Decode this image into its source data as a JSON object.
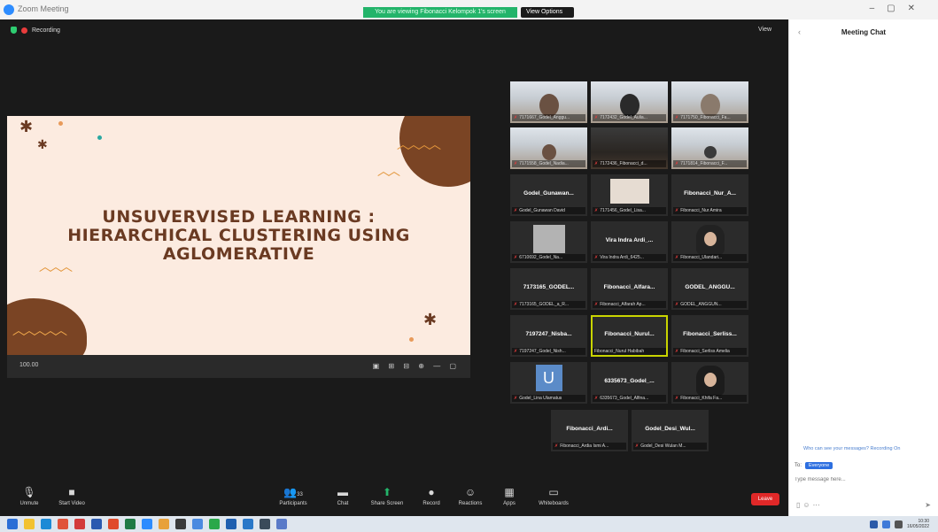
{
  "window": {
    "title": "Zoom Meeting",
    "share_banner": "You are viewing Fibonacci Kelompok 1's screen",
    "stop_share": "View Options"
  },
  "status": {
    "recording": "Recording",
    "view": "View"
  },
  "slide": {
    "title_lines": [
      "UNSUVERVISED LEARNING :",
      "HIERARCHICAL CLUSTERING USING",
      "AGLOMERATIVE"
    ],
    "zoom": "100.00",
    "tools": "▣ ⊞ ⊟ ⊕ — ▢"
  },
  "participants": [
    {
      "id": "p1",
      "big": "",
      "label": "7171667_Godel_Anggu..."
    },
    {
      "id": "p2",
      "big": "",
      "label": "7172432_Godel_Aulia..."
    },
    {
      "id": "p3",
      "big": "",
      "label": "7171750_Fibonacci_Fa..."
    },
    {
      "id": "p4",
      "big": "",
      "label": "7171558_Godel_Nadia..."
    },
    {
      "id": "p5",
      "big": "",
      "label": "7172436_Fibonacci_d..."
    },
    {
      "id": "p6",
      "big": "",
      "label": "7171814_Fibonacci_F..."
    },
    {
      "id": "p7",
      "big": "Godel_Gunawan...",
      "label": "Godel_Gunawan David"
    },
    {
      "id": "p8",
      "big": "",
      "label": "7171456_Godel_Lisa..."
    },
    {
      "id": "p9",
      "big": "Fibonacci_Nur_A...",
      "label": "Fibonacci_Nur Amira"
    },
    {
      "id": "p10",
      "big": "",
      "label": "6710692_Godel_Na..."
    },
    {
      "id": "p11",
      "big": "Vira Indra Ardi_...",
      "label": "Vira Indra Ardi_6425..."
    },
    {
      "id": "p12",
      "big": "",
      "label": "Fibonacci_Ulandari..."
    },
    {
      "id": "p13",
      "big": "7173165_GODEL...",
      "label": "7173165_GODEL_a_R..."
    },
    {
      "id": "p14",
      "big": "Fibonacci_Alfara...",
      "label": "Fibonacci_Alfarah Ap..."
    },
    {
      "id": "p15",
      "big": "GODEL_ANGGU...",
      "label": "GODEL_ANGGUN..."
    },
    {
      "id": "p16",
      "big": "7197247_Nisba...",
      "label": "7197247_Godel_Nish..."
    },
    {
      "id": "p17",
      "big": "Fibonacci_Nurul...",
      "label": "Fibonacci_Nurul Habibah"
    },
    {
      "id": "p18",
      "big": "Fibonacci_Serliss...",
      "label": "Fibonacci_Serliss Amelia"
    },
    {
      "id": "p19",
      "big": "",
      "label": "Godel_Lina Ulamatus"
    },
    {
      "id": "p20",
      "big": "6335673_Godel_...",
      "label": "6335673_Godel_Alfina..."
    },
    {
      "id": "p21",
      "big": "",
      "label": "Fibonacci_Khifa Fa..."
    },
    {
      "id": "p22",
      "big": "Fibonacci_Ardi...",
      "label": "Fibonacci_Ardia Ismi A..."
    },
    {
      "id": "p23",
      "big": "Godel_Desi_Wul...",
      "label": "Godel_Desi Wulan M..."
    }
  ],
  "avatar_letter": "U",
  "toolbar": {
    "unmute": "Unmute",
    "video": "Start Video",
    "participants": "Participants",
    "participants_count": "33",
    "chat": "Chat",
    "share": "Share Screen",
    "record": "Record",
    "reactions": "Reactions",
    "apps": "Apps",
    "whiteboards": "Whiteboards",
    "end": "Leave"
  },
  "chat": {
    "title": "Meeting Chat",
    "hint": "Who can see your messages? Recording On",
    "to_label": "To:",
    "recipient": "Everyone",
    "placeholder": "Type message here..."
  },
  "taskbar": {
    "time": "10:30",
    "date": "16/05/2022"
  },
  "colors": {
    "accent": "#23b46a",
    "end": "#e02828",
    "active_speaker": "#c9d400",
    "slide_bg": "#fcebe0",
    "slide_text": "#6a3a22"
  }
}
